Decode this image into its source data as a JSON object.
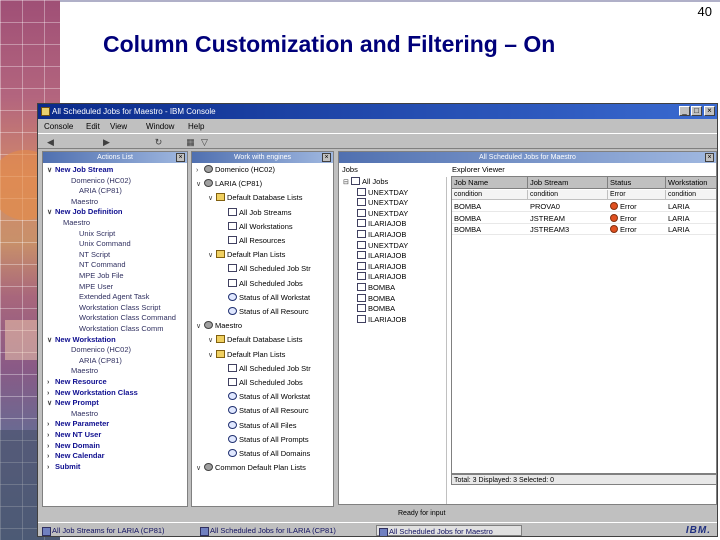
{
  "slide": {
    "number": "40",
    "title": "Column Customization and Filtering – On"
  },
  "window": {
    "title": "All Scheduled Jobs for Maestro - IBM Console",
    "controls": [
      "_",
      "□",
      "×"
    ]
  },
  "menu": [
    "Console",
    "Edit",
    "View",
    "Window",
    "Help"
  ],
  "toolbar_icons": [
    "back-icon",
    "forward-icon",
    "refresh-icon",
    "columns-icon",
    "filter-icon"
  ],
  "actions_pane": {
    "title": "Actions List",
    "items": [
      {
        "label": "New Job Stream",
        "style": "bold",
        "level": 0
      },
      {
        "label": "Domenico (HC02)",
        "style": "child",
        "level": 2
      },
      {
        "label": "ARIA (CP81)",
        "style": "child",
        "level": 3
      },
      {
        "label": "Maestro",
        "style": "child",
        "level": 2
      },
      {
        "label": "New Job Definition",
        "style": "bold",
        "level": 0
      },
      {
        "label": "Maestro",
        "style": "child",
        "level": 1
      },
      {
        "label": "Unix Script",
        "style": "child",
        "level": 3
      },
      {
        "label": "Unix Command",
        "style": "child",
        "level": 3
      },
      {
        "label": "NT Script",
        "style": "child",
        "level": 3
      },
      {
        "label": "NT Command",
        "style": "child",
        "level": 3
      },
      {
        "label": "MPE Job File",
        "style": "child",
        "level": 3
      },
      {
        "label": "MPE User",
        "style": "child",
        "level": 3
      },
      {
        "label": "Extended Agent Task",
        "style": "child",
        "level": 3
      },
      {
        "label": "Workstation Class Script",
        "style": "child",
        "level": 3
      },
      {
        "label": "Workstation Class Command",
        "style": "child",
        "level": 3
      },
      {
        "label": "Workstation Class Comm",
        "style": "child",
        "level": 3
      },
      {
        "label": "New Workstation",
        "style": "bold",
        "level": 0
      },
      {
        "label": "Domenico (HC02)",
        "style": "child",
        "level": 2
      },
      {
        "label": "ARIA (CP81)",
        "style": "child",
        "level": 3
      },
      {
        "label": "Maestro",
        "style": "child",
        "level": 2
      },
      {
        "label": "New Resource",
        "style": "bold",
        "level": 0
      },
      {
        "label": "New Workstation Class",
        "style": "bold",
        "level": 0
      },
      {
        "label": "New Prompt",
        "style": "bold",
        "level": 0
      },
      {
        "label": "Maestro",
        "style": "child",
        "level": 2
      },
      {
        "label": "New Parameter",
        "style": "bold",
        "level": 0
      },
      {
        "label": "New NT User",
        "style": "bold",
        "level": 0
      },
      {
        "label": "New Domain",
        "style": "bold",
        "level": 0
      },
      {
        "label": "New Calendar",
        "style": "bold",
        "level": 0
      },
      {
        "label": "Submit",
        "style": "bold",
        "level": 0
      }
    ]
  },
  "engines_pane": {
    "title": "Work with engines",
    "items": [
      {
        "label": "Domenico (HC02)",
        "level": 0,
        "icon": "gear"
      },
      {
        "label": "LARIA (CP81)",
        "level": 0,
        "icon": "gear"
      },
      {
        "label": "Default Database Lists",
        "level": 1,
        "icon": "folder"
      },
      {
        "label": "All Job Streams",
        "level": 2,
        "icon": "list"
      },
      {
        "label": "All Workstations",
        "level": 2,
        "icon": "list"
      },
      {
        "label": "All Resources",
        "level": 2,
        "icon": "list"
      },
      {
        "label": "Default Plan Lists",
        "level": 1,
        "icon": "folder"
      },
      {
        "label": "All Scheduled Job Str",
        "level": 2,
        "icon": "list"
      },
      {
        "label": "All Scheduled Jobs",
        "level": 2,
        "icon": "list"
      },
      {
        "label": "Status of All Workstat",
        "level": 2,
        "icon": "clock"
      },
      {
        "label": "Status of All Resourc",
        "level": 2,
        "icon": "clock"
      },
      {
        "label": "Maestro",
        "level": 0,
        "icon": "gear"
      },
      {
        "label": "Default Database Lists",
        "level": 1,
        "icon": "folder"
      },
      {
        "label": "Default Plan Lists",
        "level": 1,
        "icon": "folder"
      },
      {
        "label": "All Scheduled Job Str",
        "level": 2,
        "icon": "list"
      },
      {
        "label": "All Scheduled Jobs",
        "level": 2,
        "icon": "list"
      },
      {
        "label": "Status of All Workstat",
        "level": 2,
        "icon": "clock"
      },
      {
        "label": "Status of All Resourc",
        "level": 2,
        "icon": "clock"
      },
      {
        "label": "Status of All Files",
        "level": 2,
        "icon": "clock"
      },
      {
        "label": "Status of All Prompts",
        "level": 2,
        "icon": "clock"
      },
      {
        "label": "Status of All Domains",
        "level": 2,
        "icon": "clock"
      },
      {
        "label": "Common Default Plan Lists",
        "level": 0,
        "icon": "gear"
      }
    ]
  },
  "jobs_pane": {
    "title": "All Scheduled Jobs for Maestro",
    "tree_title": "Jobs",
    "explorer_label": "Explorer Viewer",
    "tree_items": [
      {
        "label": "All Jobs",
        "level": 0
      },
      {
        "label": "UNEXTDAY",
        "level": 1
      },
      {
        "label": "UNEXTDAY",
        "level": 1
      },
      {
        "label": "UNEXTDAY",
        "level": 1
      },
      {
        "label": "ILARIAJOB",
        "level": 1
      },
      {
        "label": "ILARIAJOB",
        "level": 1
      },
      {
        "label": "UNEXTDAY",
        "level": 1
      },
      {
        "label": "ILARIAJOB",
        "level": 1
      },
      {
        "label": "ILARIAJOB",
        "level": 1
      },
      {
        "label": "ILARIAJOB",
        "level": 1
      },
      {
        "label": "BOMBA",
        "level": 1
      },
      {
        "label": "BOMBA",
        "level": 1
      },
      {
        "label": "BOMBA",
        "level": 1
      },
      {
        "label": "ILARIAJOB",
        "level": 1
      }
    ],
    "columns": [
      "Job Name",
      "Job Stream",
      "Status",
      "Workstation"
    ],
    "filter_row": [
      "condition",
      "condition",
      "Error",
      "condition"
    ],
    "rows": [
      {
        "job": "BOMBA",
        "stream": "PROVA0",
        "status": "Error",
        "ws": "LARIA"
      },
      {
        "job": "BOMBA",
        "stream": "JSTREAM",
        "status": "Error",
        "ws": "LARIA"
      },
      {
        "job": "BOMBA",
        "stream": "JSTREAM3",
        "status": "Error",
        "ws": "LARIA"
      }
    ],
    "table_status": "Total: 3 Displayed: 3 Selected: 0"
  },
  "status_line": "Ready for input",
  "taskbar": [
    {
      "label": "All Job Streams for LARIA (CP81)",
      "active": false
    },
    {
      "label": "All Scheduled Jobs for ILARIA (CP81)",
      "active": false
    },
    {
      "label": "All Scheduled Jobs for Maestro",
      "active": true
    }
  ],
  "brand": "IBM."
}
